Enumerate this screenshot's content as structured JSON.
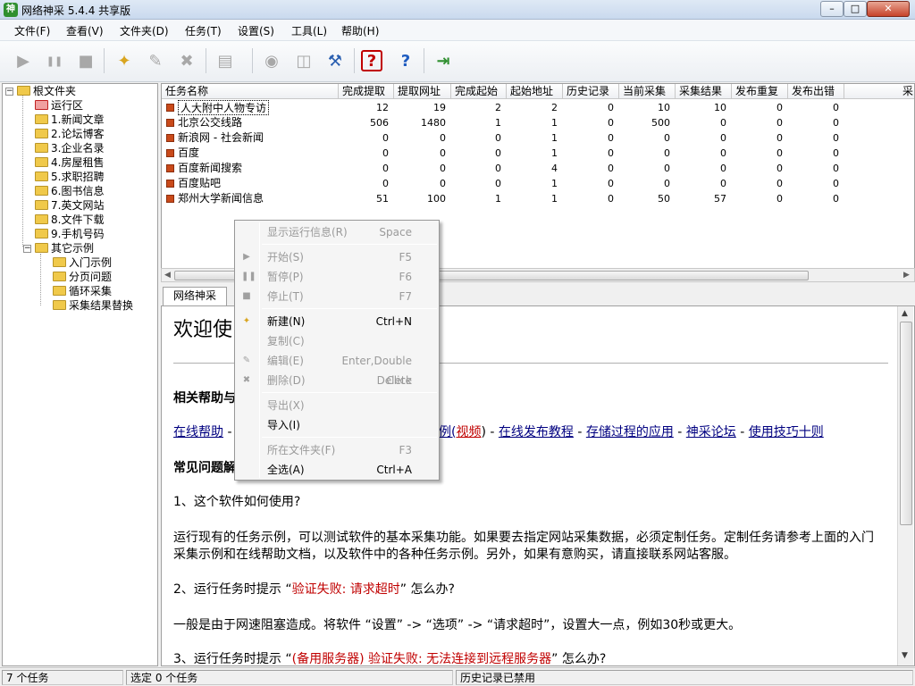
{
  "window": {
    "title": "网络神采 5.4.4 共享版",
    "icon": "app-logo-icon",
    "controls": {
      "minimize": "–",
      "maximize": "□",
      "close": "✕"
    }
  },
  "menu": [
    "文件(F)",
    "查看(V)",
    "文件夹(D)",
    "任务(T)",
    "设置(S)",
    "工具(L)",
    "帮助(H)"
  ],
  "toolbar": {
    "buttons": [
      {
        "name": "start-icon",
        "glyph": "▶",
        "enabled": false
      },
      {
        "name": "pause-icon",
        "glyph": "❚❚",
        "enabled": false
      },
      {
        "name": "stop-icon",
        "glyph": "■",
        "enabled": false
      },
      {
        "name": "new-task-icon",
        "glyph": "✦",
        "enabled": true
      },
      {
        "name": "edit-task-icon",
        "glyph": "✎",
        "enabled": false
      },
      {
        "name": "delete-task-icon",
        "glyph": "✖",
        "enabled": false
      },
      {
        "name": "save-icon",
        "glyph": "▤",
        "enabled": false
      },
      {
        "name": "disabled-circle-icon",
        "glyph": "◉",
        "enabled": false
      },
      {
        "name": "export-icon",
        "glyph": "◫",
        "enabled": false
      },
      {
        "name": "tools-icon",
        "glyph": "⚒",
        "enabled": true
      },
      {
        "name": "help-icon",
        "glyph": "?",
        "enabled": true
      },
      {
        "name": "context-help-icon",
        "glyph": "?",
        "enabled": true
      },
      {
        "name": "exit-icon",
        "glyph": "⇥",
        "enabled": true
      }
    ]
  },
  "tree": {
    "root": "根文件夹",
    "nodes": [
      {
        "label": "运行区",
        "special": true
      },
      {
        "label": "1.新闻文章"
      },
      {
        "label": "2.论坛博客"
      },
      {
        "label": "3.企业名录"
      },
      {
        "label": "4.房屋租售"
      },
      {
        "label": "5.求职招聘"
      },
      {
        "label": "6.图书信息"
      },
      {
        "label": "7.英文网站"
      },
      {
        "label": "8.文件下载"
      },
      {
        "label": "9.手机号码"
      },
      {
        "label": "其它示例"
      }
    ],
    "examples": [
      "入门示例",
      "分页问题",
      "循环采集",
      "采集结果替换"
    ],
    "expander_minus": "−"
  },
  "task_list": {
    "columns": [
      "任务名称",
      "完成提取",
      "提取网址",
      "完成起始",
      "起始地址",
      "历史记录",
      "当前采集",
      "采集结果",
      "发布重复",
      "发布出错",
      "采"
    ],
    "rows": [
      {
        "name": "人大附中人物专访",
        "values": [
          "12",
          "19",
          "2",
          "2",
          "0",
          "10",
          "10",
          "0",
          "0"
        ]
      },
      {
        "name": "北京公交线路",
        "values": [
          "506",
          "1480",
          "1",
          "1",
          "0",
          "500",
          "0",
          "0",
          "0"
        ]
      },
      {
        "name": "新浪网 - 社会新闻",
        "values": [
          "0",
          "0",
          "0",
          "1",
          "0",
          "0",
          "0",
          "0",
          "0"
        ]
      },
      {
        "name": "百度",
        "values": [
          "0",
          "0",
          "0",
          "1",
          "0",
          "0",
          "0",
          "0",
          "0"
        ]
      },
      {
        "name": "百度新闻搜索",
        "values": [
          "0",
          "0",
          "0",
          "4",
          "0",
          "0",
          "0",
          "0",
          "0"
        ]
      },
      {
        "name": "百度贴吧",
        "values": [
          "0",
          "0",
          "0",
          "1",
          "0",
          "0",
          "0",
          "0",
          "0"
        ]
      },
      {
        "name": "郑州大学新闻信息",
        "values": [
          "51",
          "100",
          "1",
          "1",
          "0",
          "50",
          "57",
          "0",
          "0"
        ]
      }
    ]
  },
  "tab": {
    "label": "网络神采"
  },
  "content": {
    "title": "欢迎使",
    "help_heading": "相关帮助与",
    "links_left": "在线帮助",
    "links_dash": " -",
    "link_mid_a": "例(",
    "link_video": "视频",
    "link_mid_b": ")",
    "link_sep": " - ",
    "link_publish": "在线发布教程",
    "link_storage": "存储过程的应用",
    "link_forum": "神采论坛",
    "link_tips": "使用技巧十则",
    "faq_heading": "常见问题解",
    "q1": "1、这个软件如何使用?",
    "a1_line1": "运行现有的任务示例，可以测试软件的基本采集功能。如果要去指定网站采集数据，必须定制任务。定制任务请参考上面的入门",
    "a1_line2": "采集示例和在线帮助文档，以及软件中的各种任务示例。另外，如果有意购买，请直接联系网站客服。",
    "q2_prefix": "2、运行任务时提示 “",
    "q2_red": "验证失败: 请求超时",
    "q2_suffix": "” 怎么办?",
    "a2": "一般是由于网速阻塞造成。将软件 “设置” -> “选项” -> “请求超时”，设置大一点，例如30秒或更大。",
    "q3_prefix": "3、运行任务时提示 “",
    "q3_red": "(备用服务器) 验证失败: 无法连接到远程服务器",
    "q3_suffix": "” 怎么办?"
  },
  "context_menu": {
    "items": [
      {
        "label": "显示运行信息(R)",
        "key": "Space",
        "enabled": false,
        "icon": ""
      },
      {
        "sep": true
      },
      {
        "label": "开始(S)",
        "key": "F5",
        "enabled": false,
        "icon": "start-icon",
        "glyph": "▶"
      },
      {
        "label": "暂停(P)",
        "key": "F6",
        "enabled": false,
        "icon": "pause-icon",
        "glyph": "❚❚"
      },
      {
        "label": "停止(T)",
        "key": "F7",
        "enabled": false,
        "icon": "stop-icon",
        "glyph": "■"
      },
      {
        "sep": true
      },
      {
        "label": "新建(N)",
        "key": "Ctrl+N",
        "enabled": true,
        "icon": "new-task-icon",
        "glyph": "✦"
      },
      {
        "label": "复制(C)",
        "key": "",
        "enabled": false,
        "icon": ""
      },
      {
        "label": "编辑(E)",
        "key": "Enter,Double Click",
        "enabled": false,
        "icon": "edit-task-icon",
        "glyph": "✎"
      },
      {
        "label": "删除(D)",
        "key": "Delete",
        "enabled": false,
        "icon": "delete-task-icon",
        "glyph": "✖"
      },
      {
        "sep": true
      },
      {
        "label": "导出(X)",
        "key": "",
        "enabled": false,
        "icon": ""
      },
      {
        "label": "导入(I)",
        "key": "",
        "enabled": true,
        "icon": ""
      },
      {
        "sep": true
      },
      {
        "label": "所在文件夹(F)",
        "key": "F3",
        "enabled": false,
        "icon": ""
      },
      {
        "label": "全选(A)",
        "key": "Ctrl+A",
        "enabled": true,
        "icon": ""
      }
    ]
  },
  "status_bar": {
    "task_count": "7 个任务",
    "selected": "选定 0 个任务",
    "history": "历史记录已禁用"
  },
  "colors": {
    "link": "#000080",
    "warning": "#c00000",
    "task_icon": "#c94a1a"
  }
}
